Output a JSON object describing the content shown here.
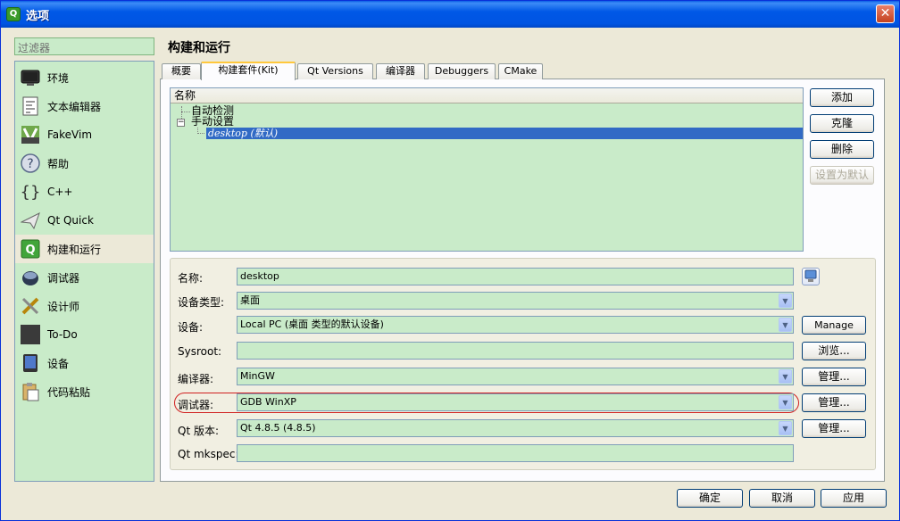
{
  "window": {
    "title": "选项",
    "icon": "qt-creator-icon",
    "close_label": "✕"
  },
  "filter": {
    "placeholder": "过滤器"
  },
  "sidebar": {
    "items": [
      {
        "label": "环境",
        "icon": "monitor-icon"
      },
      {
        "label": "文本编辑器",
        "icon": "text-editor-icon"
      },
      {
        "label": "FakeVim",
        "icon": "fakevim-icon"
      },
      {
        "label": "帮助",
        "icon": "help-icon"
      },
      {
        "label": "C++",
        "icon": "braces-icon"
      },
      {
        "label": "Qt Quick",
        "icon": "paper-plane-icon"
      },
      {
        "label": "构建和运行",
        "icon": "build-run-icon",
        "selected": true
      },
      {
        "label": "调试器",
        "icon": "debugger-icon"
      },
      {
        "label": "设计师",
        "icon": "designer-icon"
      },
      {
        "label": "To-Do",
        "icon": "todo-icon"
      },
      {
        "label": "设备",
        "icon": "device-icon"
      },
      {
        "label": "代码粘贴",
        "icon": "code-paste-icon"
      }
    ]
  },
  "page": {
    "title": "构建和运行"
  },
  "tabs": [
    {
      "label": "概要"
    },
    {
      "label": "构建套件(Kit)",
      "active": true
    },
    {
      "label": "Qt Versions"
    },
    {
      "label": "编译器"
    },
    {
      "label": "Debuggers"
    },
    {
      "label": "CMake"
    }
  ],
  "kit_tree": {
    "header": "名称",
    "auto_detected": "自动检测",
    "manual": "手动设置",
    "selected_kit": "desktop (默认)"
  },
  "kit_buttons": {
    "add": "添加",
    "clone": "克隆",
    "remove": "删除",
    "make_default": "设置为默认"
  },
  "details": {
    "name": {
      "label": "名称:",
      "value": "desktop"
    },
    "device_type": {
      "label": "设备类型:",
      "value": "桌面"
    },
    "device": {
      "label": "设备:",
      "value": "Local PC (桌面 类型的默认设备)",
      "button": "Manage"
    },
    "sysroot": {
      "label": "Sysroot:",
      "value": "",
      "button": "浏览..."
    },
    "compiler": {
      "label": "编译器:",
      "value": "MinGW",
      "button": "管理..."
    },
    "debugger": {
      "label": "调试器:",
      "value": "GDB WinXP",
      "button": "管理..."
    },
    "qt_version": {
      "label": "Qt 版本:",
      "value": "Qt 4.8.5 (4.8.5)",
      "button": "管理..."
    },
    "qt_mkspec": {
      "label": "Qt mkspec:",
      "value": ""
    }
  },
  "dialog_buttons": {
    "ok": "确定",
    "cancel": "取消",
    "apply": "应用"
  },
  "colors": {
    "field_bg": "#c9ebc9",
    "selection": "#316ac5",
    "titlebar": "#0054e3",
    "highlight_ring": "#d02020"
  }
}
